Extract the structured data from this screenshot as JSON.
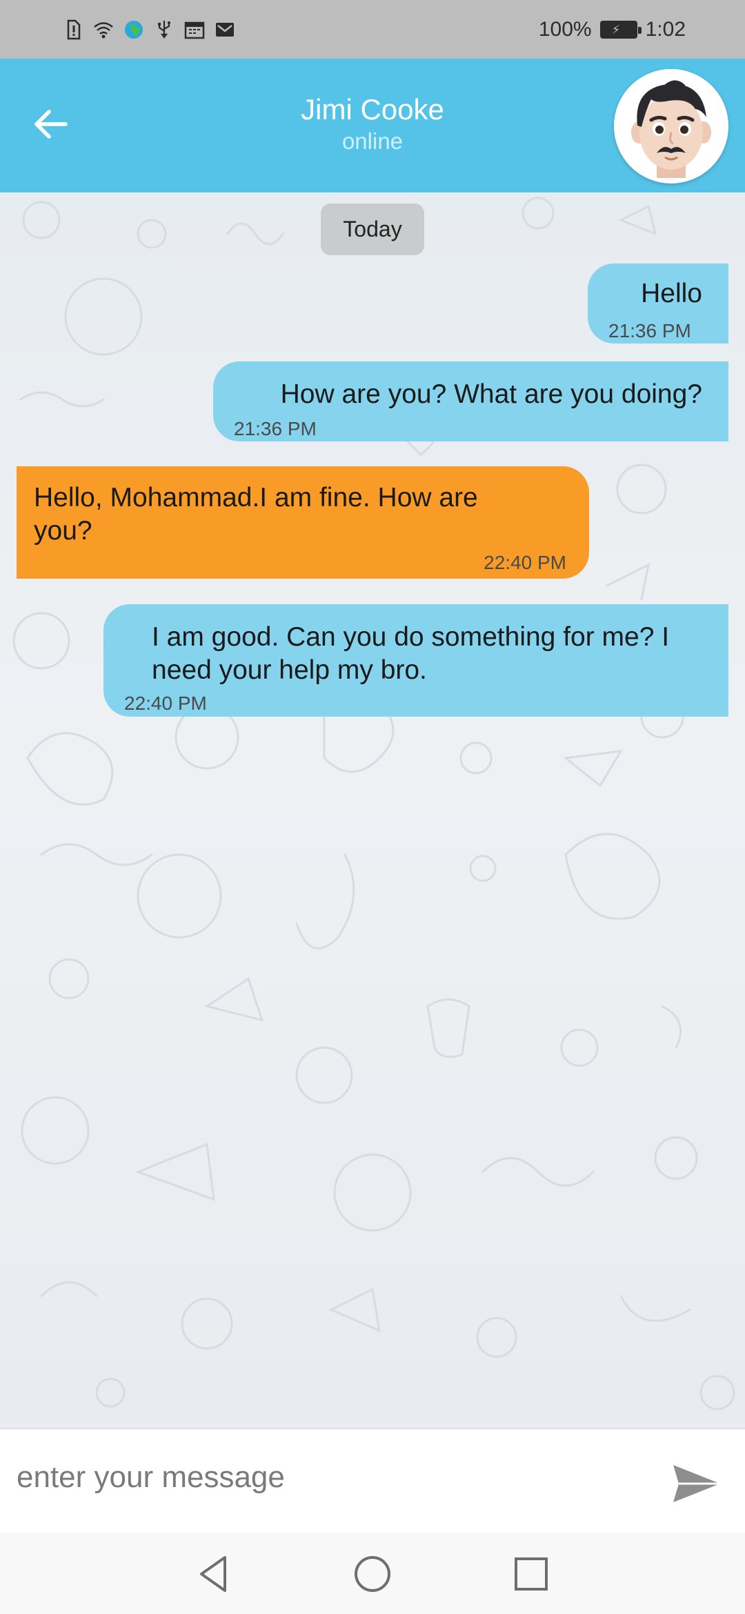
{
  "status_bar": {
    "battery_percent": "100%",
    "time": "1:02",
    "icons": [
      "sim-alert-icon",
      "wifi-icon",
      "vpn-globe-icon",
      "usb-icon",
      "calendar-icon",
      "mail-icon",
      "battery-charging-icon"
    ]
  },
  "header": {
    "contact_name": "Jimi Cooke",
    "contact_status": "online",
    "back_icon": "back-arrow-icon",
    "avatar": "contact-avatar"
  },
  "chat": {
    "date_label": "Today",
    "messages": [
      {
        "direction": "outgoing",
        "text": "Hello",
        "time": "21:36 PM"
      },
      {
        "direction": "outgoing",
        "text": "How are you? What are you doing?",
        "time": "21:36 PM"
      },
      {
        "direction": "incoming",
        "text": "Hello, Mohammad.I am fine. How are you?",
        "time": "22:40 PM"
      },
      {
        "direction": "outgoing",
        "text": "I am good. Can you do something for me? I need your help my bro.",
        "time": "22:40 PM"
      }
    ]
  },
  "composer": {
    "placeholder": "enter your message",
    "value": "",
    "send_icon": "send-icon"
  },
  "colors": {
    "app_bar": "#55c3e7",
    "outgoing_bubble": "#85d3ed",
    "incoming_bubble": "#f89c27",
    "status_bar": "#bdbdbd"
  },
  "nav": {
    "icons": [
      "nav-back-icon",
      "nav-home-icon",
      "nav-recents-icon"
    ]
  }
}
